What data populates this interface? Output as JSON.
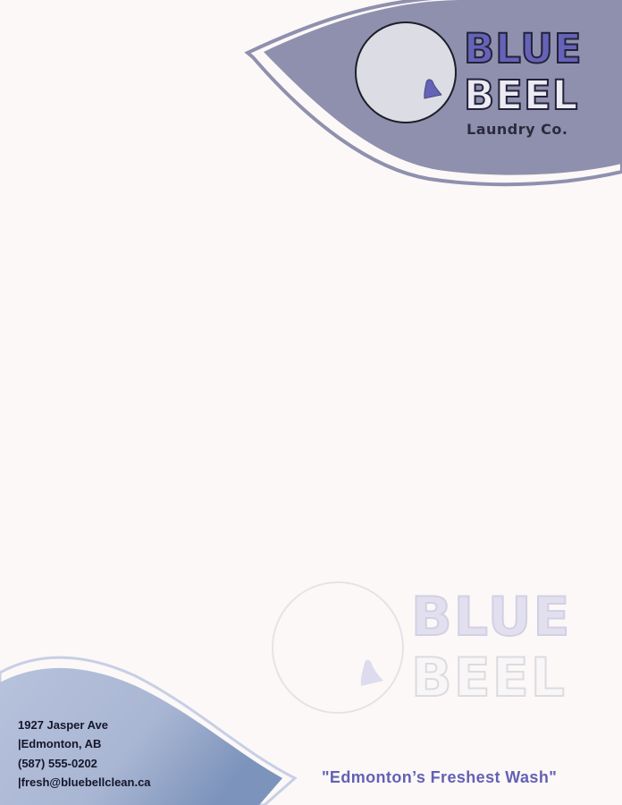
{
  "brand": {
    "name_line1": "BLUE",
    "name_line2": "BEEL",
    "subtitle": "Laundry Co."
  },
  "watermark": {
    "name_line1": "BLUE",
    "name_line2": "BEEL"
  },
  "contact": {
    "street": "1927 Jasper Ave",
    "city": "|Edmonton, AB",
    "phone": "(587) 555-0202",
    "email": "|fresh@bluebellclean.ca"
  },
  "tagline": "\"Edmonton’s Freshest Wash\"",
  "colors": {
    "background": "#fcf8f7",
    "header_swoosh": "#8f90ae",
    "brand_accent": "#6563b8",
    "footer_gradient_start": "#b6c1db",
    "footer_gradient_end": "#7f97bd"
  },
  "icons": [
    "bell-icon",
    "watermark-bell-icon"
  ]
}
